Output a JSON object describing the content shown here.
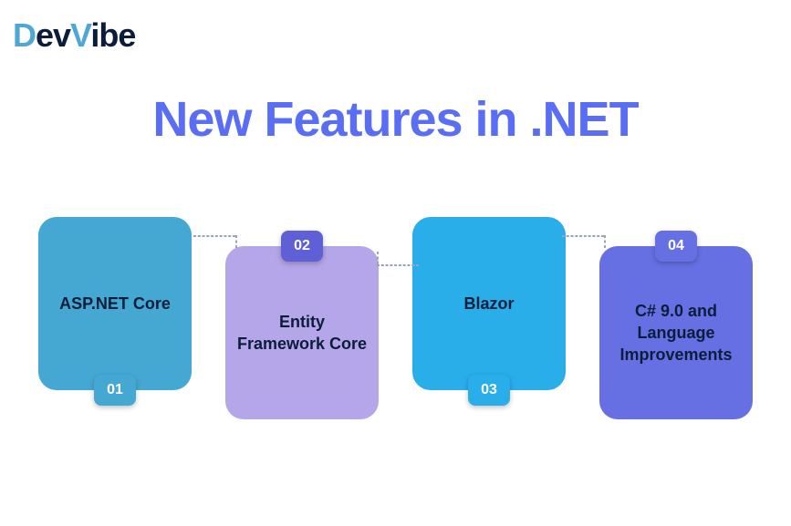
{
  "logo": {
    "part1": "D",
    "part2": "ev",
    "part3": "V",
    "part4": "ibe"
  },
  "title": "New Features in .NET",
  "cards": [
    {
      "num": "01",
      "label": "ASP.NET Core"
    },
    {
      "num": "02",
      "label": "Entity Framework Core"
    },
    {
      "num": "03",
      "label": "Blazor"
    },
    {
      "num": "04",
      "label": "C# 9.0 and Language Improvements"
    }
  ]
}
